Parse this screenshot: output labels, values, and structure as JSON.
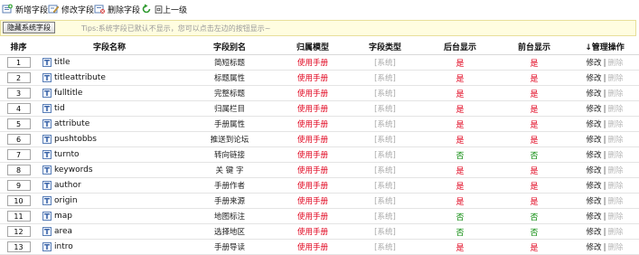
{
  "toolbar": {
    "add_label": "新增字段",
    "edit_label": "修改字段",
    "delete_label": "删除字段",
    "back_label": "回上一级"
  },
  "tipbar": {
    "hide_button_label": "隐藏系统字段",
    "tips": "Tips:系统字段已默认不显示，您可以点击左边的按钮显示~"
  },
  "table": {
    "headers": [
      "排序",
      "字段名称",
      "字段别名",
      "归属模型",
      "字段类型",
      "后台显示",
      "前台显示",
      "↓管理操作"
    ],
    "model_text": "使用手册",
    "type_text": "[系统]",
    "edit_text": "修改",
    "sep_text": "|",
    "delete_text": "删除",
    "rows": [
      {
        "order": "1",
        "name": "title",
        "alias": "简短标题",
        "backend": "是",
        "frontend": "是"
      },
      {
        "order": "2",
        "name": "titleattribute",
        "alias": "标题属性",
        "backend": "是",
        "frontend": "是"
      },
      {
        "order": "3",
        "name": "fulltitle",
        "alias": "完整标题",
        "backend": "是",
        "frontend": "是"
      },
      {
        "order": "4",
        "name": "tid",
        "alias": "归属栏目",
        "backend": "是",
        "frontend": "是"
      },
      {
        "order": "5",
        "name": "attribute",
        "alias": "手册属性",
        "backend": "是",
        "frontend": "是"
      },
      {
        "order": "6",
        "name": "pushtobbs",
        "alias": "推送到论坛",
        "backend": "是",
        "frontend": "是"
      },
      {
        "order": "7",
        "name": "turnto",
        "alias": "转向链接",
        "backend": "否",
        "frontend": "否"
      },
      {
        "order": "8",
        "name": "keywords",
        "alias": "关 键 字",
        "backend": "是",
        "frontend": "是"
      },
      {
        "order": "9",
        "name": "author",
        "alias": "手册作者",
        "backend": "是",
        "frontend": "是"
      },
      {
        "order": "10",
        "name": "origin",
        "alias": "手册来源",
        "backend": "是",
        "frontend": "是"
      },
      {
        "order": "11",
        "name": "map",
        "alias": "地图标注",
        "backend": "否",
        "frontend": "否"
      },
      {
        "order": "12",
        "name": "area",
        "alias": "选择地区",
        "backend": "否",
        "frontend": "否"
      },
      {
        "order": "13",
        "name": "intro",
        "alias": "手册导读",
        "backend": "是",
        "frontend": "是"
      }
    ]
  },
  "colors": {
    "yes": "#e0001b",
    "no": "#0a8a0a",
    "tip_bg": "#fffde0"
  }
}
